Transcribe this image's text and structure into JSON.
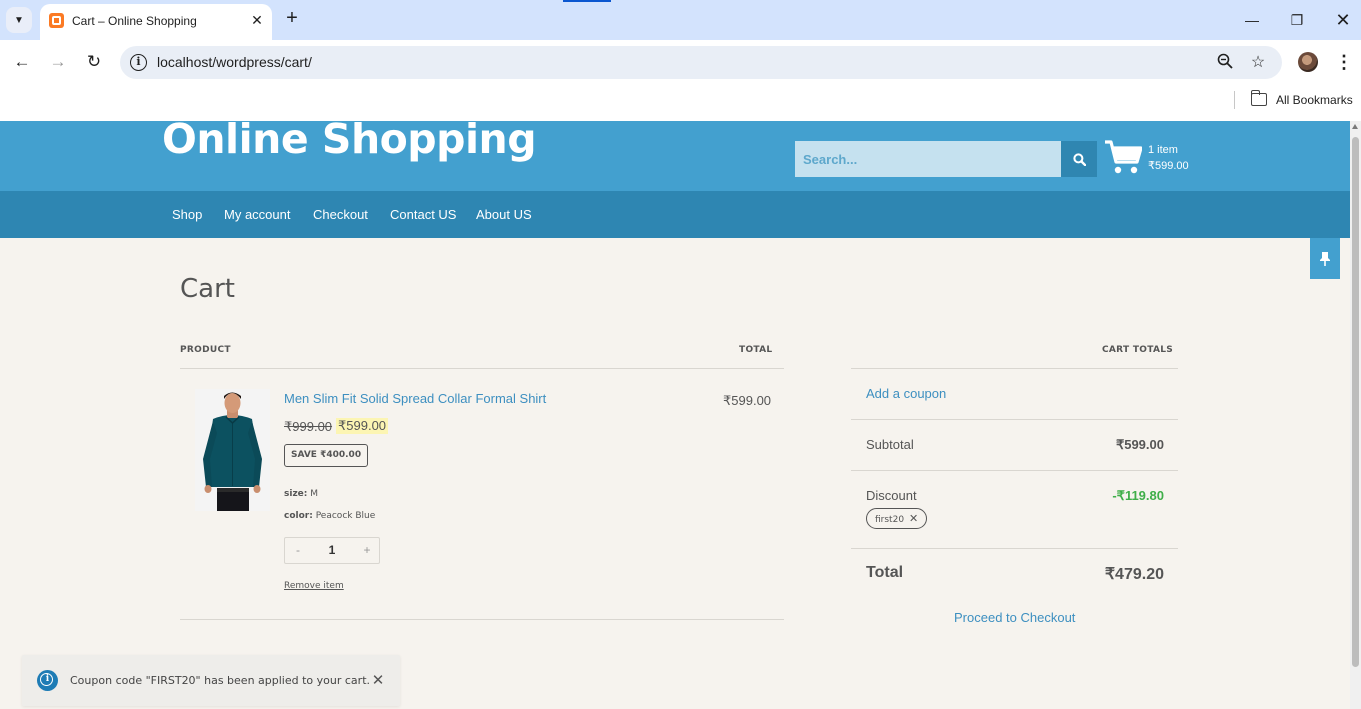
{
  "browser": {
    "tab_title": "Cart – Online Shopping",
    "url": "localhost/wordpress/cart/",
    "bookmarks_label": "All Bookmarks"
  },
  "site": {
    "title": "Online Shopping",
    "search_placeholder": "Search...",
    "cart_count": "1 item",
    "cart_amount": "₹599.00",
    "nav": [
      "Shop",
      "My account",
      "Checkout",
      "Contact US",
      "About US"
    ]
  },
  "cart": {
    "page_title": "Cart",
    "col_product": "PRODUCT",
    "col_total": "TOTAL",
    "item": {
      "name": "Men Slim Fit Solid Spread Collar Formal Shirt",
      "regular_price": "₹999.00",
      "sale_price": "₹599.00",
      "save_badge": "SAVE ₹400.00",
      "size_label": "size:",
      "size_value": "M",
      "color_label": "color:",
      "color_value": "Peacock Blue",
      "qty_minus": "-",
      "quantity": "1",
      "qty_plus": "+",
      "remove_label": "Remove item",
      "line_total": "₹599.00"
    }
  },
  "totals": {
    "heading": "CART TOTALS",
    "add_coupon": "Add a coupon",
    "subtotal_label": "Subtotal",
    "subtotal_value": "₹599.00",
    "discount_label": "Discount",
    "discount_value": "-₹119.80",
    "coupon_code": "first20",
    "total_label": "Total",
    "total_value": "₹479.20",
    "checkout_label": "Proceed to Checkout"
  },
  "notice": {
    "text": "Coupon code \"FIRST20\" has been applied to your cart."
  },
  "colors": {
    "header": "#43a0cf",
    "nav": "#2e86b2",
    "link": "#3d8fc0",
    "discount": "#3fae49",
    "page_bg": "#f6f3ee"
  }
}
